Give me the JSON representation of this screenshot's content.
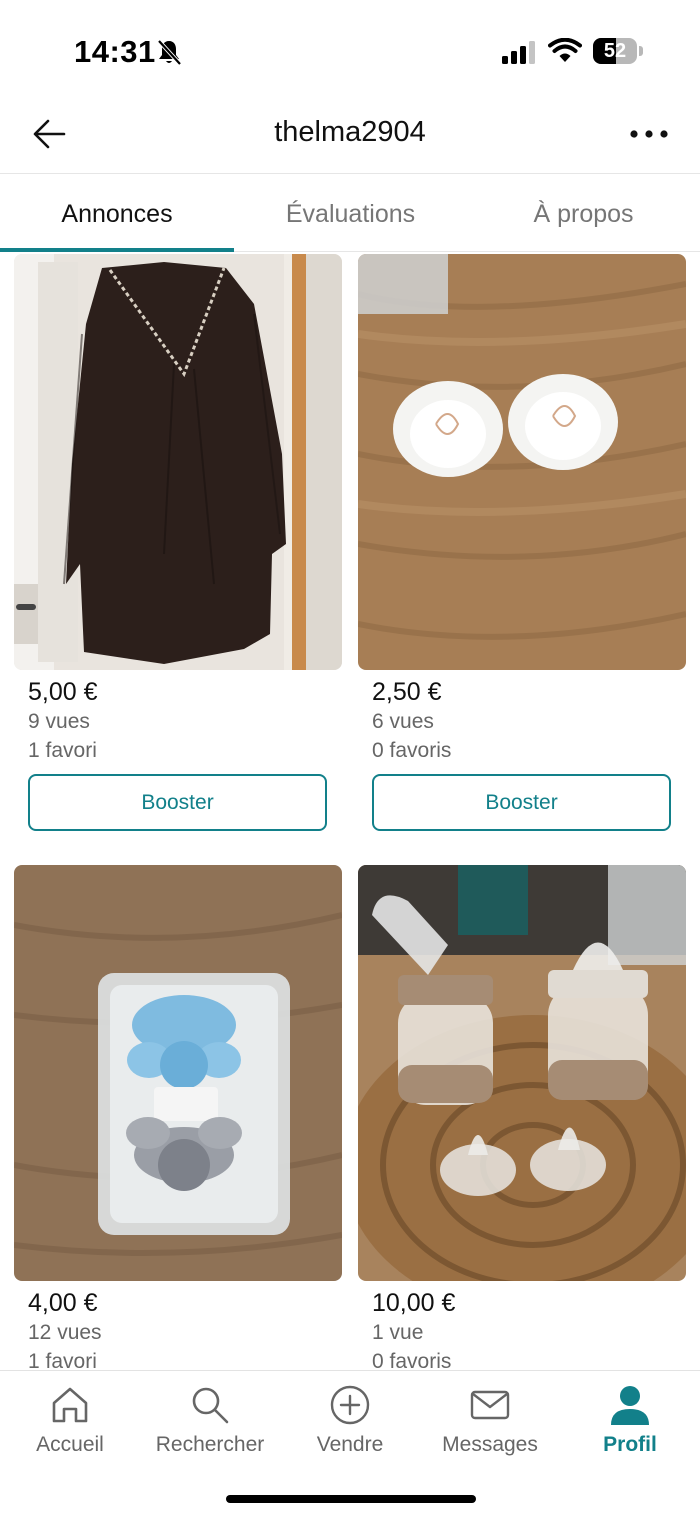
{
  "status_bar": {
    "time": "14:31",
    "battery": "52",
    "battery_level": 0.52
  },
  "header": {
    "title": "thelma2904",
    "back_icon": "arrow-left-icon",
    "more_icon": "more-horizontal-icon"
  },
  "tabs": [
    {
      "label": "Annonces",
      "active": true
    },
    {
      "label": "Évaluations",
      "active": false
    },
    {
      "label": "À propos",
      "active": false
    }
  ],
  "listings": [
    {
      "price": "5,00 €",
      "views": "9 vues",
      "favorites": "1 favori",
      "boost_label": "Booster",
      "image": "black-dress"
    },
    {
      "price": "2,50 €",
      "views": "6 vues",
      "favorites": "0 favoris",
      "boost_label": "Booster",
      "image": "white-pacifiers"
    },
    {
      "price": "4,00 €",
      "views": "12 vues",
      "favorites": "1 favori",
      "image": "pacifiers-in-box"
    },
    {
      "price": "10,00 €",
      "views": "1 vue",
      "favorites": "0 favoris",
      "image": "baby-bottles"
    }
  ],
  "bottom_nav": [
    {
      "label": "Accueil",
      "icon": "home-icon",
      "active": false
    },
    {
      "label": "Rechercher",
      "icon": "search-icon",
      "active": false
    },
    {
      "label": "Vendre",
      "icon": "plus-circle-icon",
      "active": false
    },
    {
      "label": "Messages",
      "icon": "mail-icon",
      "active": false
    },
    {
      "label": "Profil",
      "icon": "profile-icon",
      "active": true
    }
  ],
  "colors": {
    "accent": "#12808a",
    "text": "#111111",
    "muted": "#666666"
  }
}
